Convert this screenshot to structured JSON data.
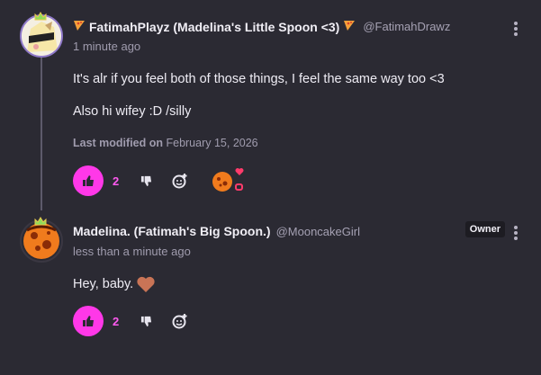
{
  "comments": [
    {
      "display_name": "FatimahPlayz (Madelina's Little Spoon <3)",
      "handle": "@FatimahDrawz",
      "timestamp": "1 minute ago",
      "paragraphs": [
        "It's alr if you feel both of those things, I feel the same way too <3",
        "Also hi wifey :D /silly"
      ],
      "last_modified_label": "Last modified on",
      "last_modified_date": "February 15, 2026",
      "like_count": "2",
      "icons": {
        "name_prefix": "pizza-icon",
        "like": "thumbs-up-icon",
        "dislike": "thumbs-down-icon",
        "react": "add-reaction-icon",
        "menu": "kebab-menu-icon"
      }
    },
    {
      "display_name": "Madelina. (Fatimah's Big Spoon.)",
      "handle": "@MooncakeGirl",
      "timestamp": "less than a minute ago",
      "badge": "Owner",
      "paragraphs": [
        "Hey, baby."
      ],
      "like_count": "2",
      "icons": {
        "body_emoji": "heart-icon",
        "like": "thumbs-up-icon",
        "dislike": "thumbs-down-icon",
        "react": "add-reaction-icon",
        "menu": "kebab-menu-icon"
      }
    }
  ],
  "colors": {
    "background": "#2b2a33",
    "like_accent": "#ff38e8",
    "heart": "#c97456",
    "reaction_red": "#ff3b6b"
  }
}
